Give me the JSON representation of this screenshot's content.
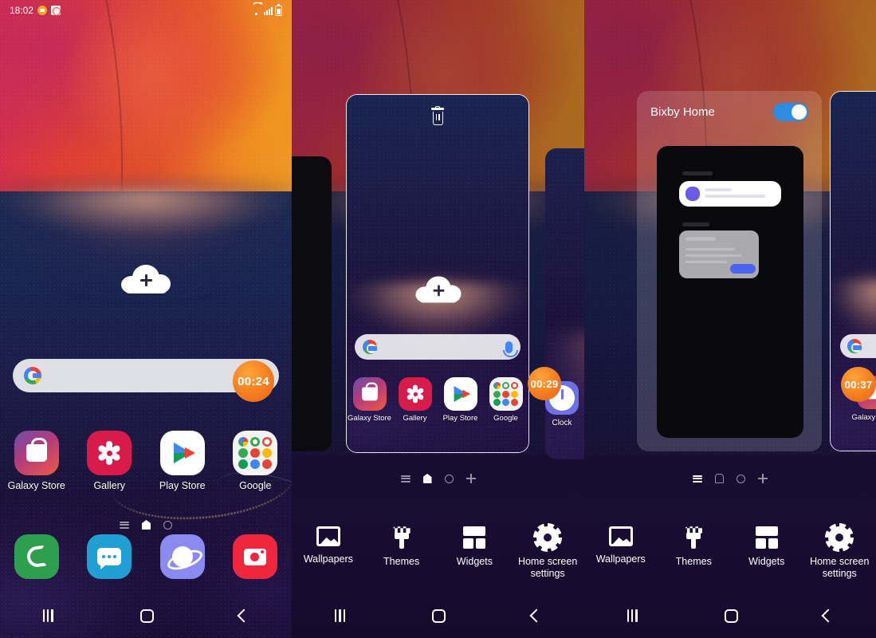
{
  "panels": {
    "left": {
      "name": "home-screen",
      "statusbar": {
        "time": "18:02",
        "icons_left": [
          "chat-icon",
          "location-icon"
        ],
        "icons_right": [
          "wifi-icon",
          "signal-icon",
          "battery-icon"
        ]
      },
      "search": {
        "logo": "google-logo-icon",
        "placeholder": "",
        "timer_badge": "00:24"
      },
      "apps": [
        {
          "label": "Galaxy Store",
          "icon": "galaxy-store-icon"
        },
        {
          "label": "Gallery",
          "icon": "gallery-icon"
        },
        {
          "label": "Play Store",
          "icon": "play-store-icon"
        },
        {
          "label": "Google",
          "icon": "google-folder-icon"
        }
      ],
      "page_indicators": [
        "bixby-page",
        "home-page",
        "page-dot"
      ],
      "active_page": "home-page",
      "dock": [
        {
          "label": "Phone",
          "icon": "phone-icon"
        },
        {
          "label": "Messages",
          "icon": "messages-icon"
        },
        {
          "label": "Internet",
          "icon": "internet-icon"
        },
        {
          "label": "Camera",
          "icon": "camera-icon"
        }
      ],
      "cloud_widget": "cloud-add-icon"
    },
    "mid": {
      "name": "home-screen-edit-mode",
      "top_icon": "home-icon",
      "card": {
        "remove_icon": "trash-icon",
        "timer_badge": "00:29"
      },
      "search": {
        "logo": "google-logo-icon",
        "mic": "mic-icon"
      },
      "apps": [
        {
          "label": "Galaxy Store",
          "icon": "galaxy-store-icon"
        },
        {
          "label": "Gallery",
          "icon": "gallery-icon"
        },
        {
          "label": "Play Store",
          "icon": "play-store-icon"
        },
        {
          "label": "Google",
          "icon": "google-folder-icon"
        }
      ],
      "side_app": {
        "label": "Clock",
        "icon": "clock-icon"
      },
      "page_indicators": [
        "bixby-page",
        "home-page",
        "page-dot",
        "add-page"
      ],
      "active_page": "home-page",
      "toolbar": [
        {
          "label": "Wallpapers",
          "icon": "wallpaper-icon"
        },
        {
          "label": "Themes",
          "icon": "theme-brush-icon"
        },
        {
          "label": "Widgets",
          "icon": "widgets-icon"
        },
        {
          "label": "Home screen settings",
          "icon": "gear-icon"
        }
      ]
    },
    "right": {
      "name": "bixby-home-edit-mode",
      "title": "Bixby Home",
      "toggle": {
        "state": "on",
        "color": "#2f8de0"
      },
      "side_timer_badge": "00:37",
      "side_app": {
        "label": "Galaxy Store",
        "icon": "galaxy-store-icon"
      },
      "page_indicators": [
        "bixby-page",
        "home-page",
        "page-dot",
        "add-page"
      ],
      "active_page": "bixby-page",
      "toolbar": [
        {
          "label": "Wallpapers",
          "icon": "wallpaper-icon"
        },
        {
          "label": "Themes",
          "icon": "theme-brush-icon"
        },
        {
          "label": "Widgets",
          "icon": "widgets-icon"
        },
        {
          "label": "Home screen settings",
          "icon": "gear-icon"
        }
      ]
    }
  },
  "navbar": {
    "recents": "recents-icon",
    "home": "home-icon",
    "back": "back-icon"
  },
  "colors": {
    "toggle_on": "#2f8de0",
    "timer_badge": "#f57c1f",
    "accent_blue": "#4a63f0"
  }
}
